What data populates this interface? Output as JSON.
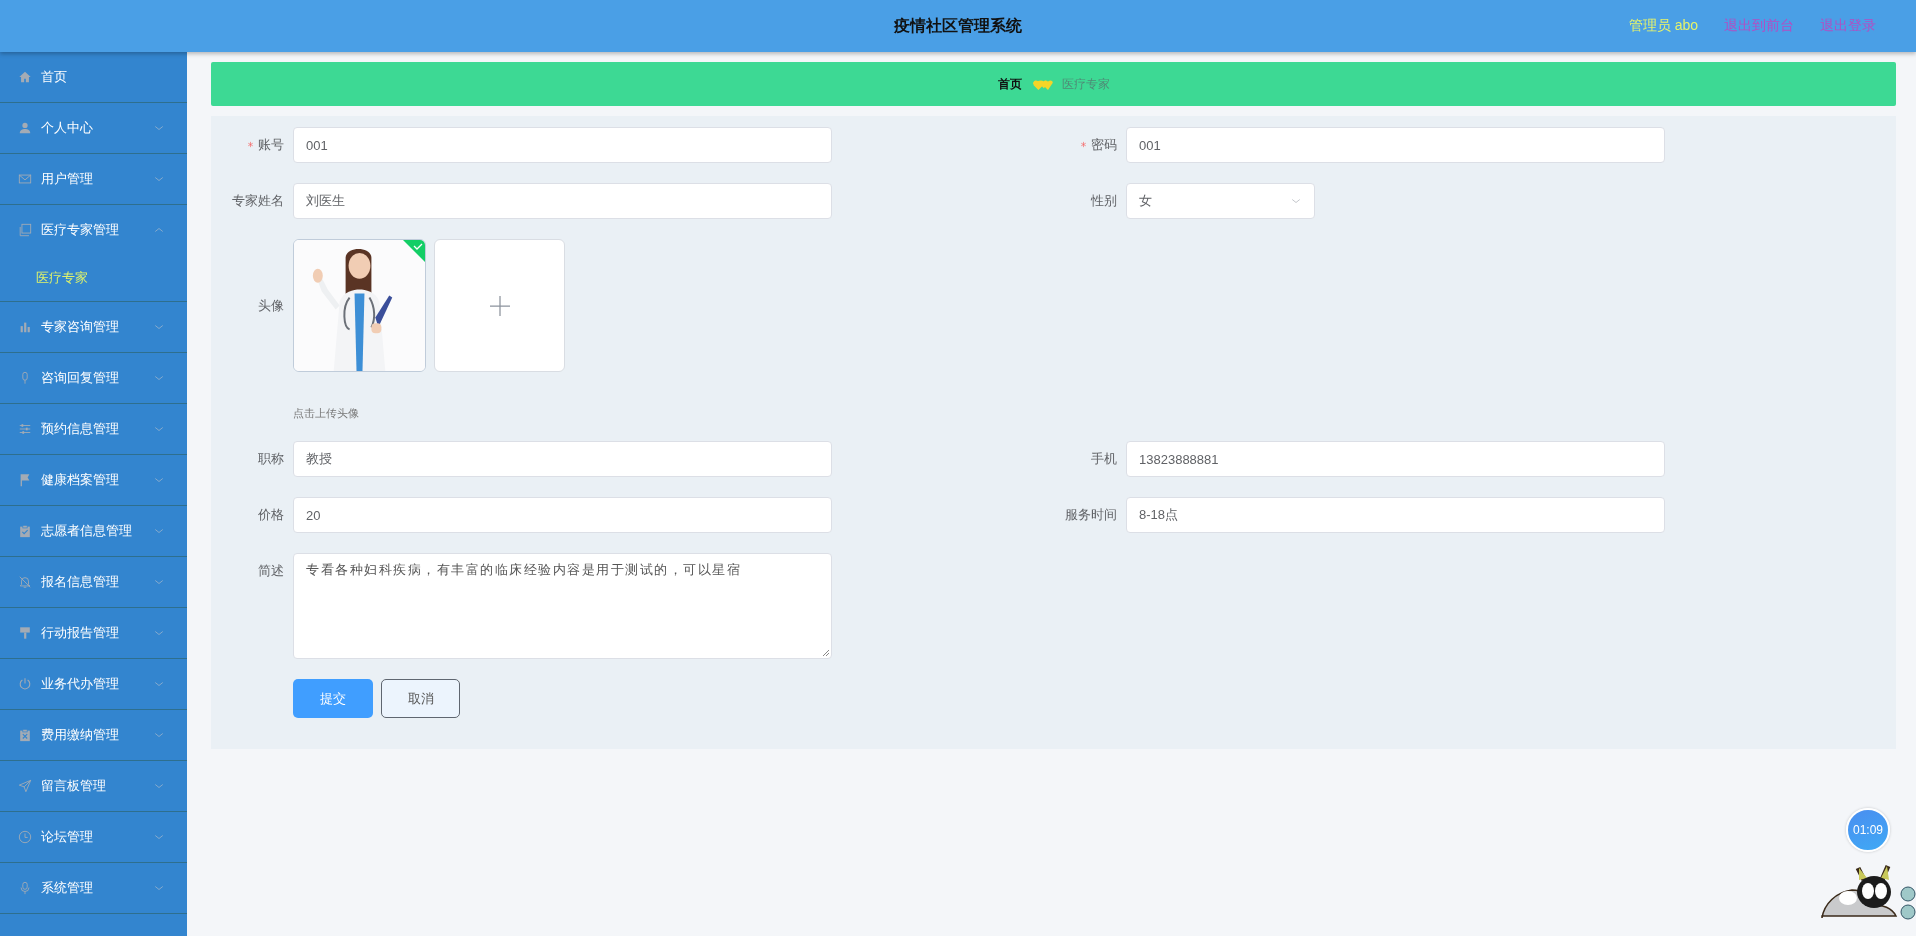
{
  "header": {
    "title": "疫情社区管理系统",
    "user": "管理员 abo",
    "links": [
      "退出到前台",
      "退出登录"
    ]
  },
  "sidebar": {
    "items": [
      {
        "label": "首页",
        "kind": "link"
      },
      {
        "label": "个人中心",
        "kind": "menu",
        "expanded": false
      },
      {
        "label": "用户管理",
        "kind": "menu",
        "expanded": false
      },
      {
        "label": "医疗专家管理",
        "kind": "menu",
        "expanded": true,
        "children": [
          {
            "label": "医疗专家",
            "selected": true
          }
        ]
      },
      {
        "label": "专家咨询管理",
        "kind": "menu",
        "expanded": false
      },
      {
        "label": "咨询回复管理",
        "kind": "menu",
        "expanded": false
      },
      {
        "label": "预约信息管理",
        "kind": "menu",
        "expanded": false
      },
      {
        "label": "健康档案管理",
        "kind": "menu",
        "expanded": false
      },
      {
        "label": "志愿者信息管理",
        "kind": "menu",
        "expanded": false
      },
      {
        "label": "报名信息管理",
        "kind": "menu",
        "expanded": false
      },
      {
        "label": "行动报告管理",
        "kind": "menu",
        "expanded": false
      },
      {
        "label": "业务代办管理",
        "kind": "menu",
        "expanded": false
      },
      {
        "label": "费用缴纳管理",
        "kind": "menu",
        "expanded": false
      },
      {
        "label": "留言板管理",
        "kind": "menu",
        "expanded": false
      },
      {
        "label": "论坛管理",
        "kind": "menu",
        "expanded": false
      },
      {
        "label": "系统管理",
        "kind": "menu",
        "expanded": false
      }
    ]
  },
  "breadcrumb": [
    {
      "label": "首页",
      "current": false
    },
    {
      "label": "医疗专家",
      "current": true
    }
  ],
  "form": {
    "rows": [
      [
        {
          "label": "账号",
          "required": true,
          "kind": "text",
          "value": "001"
        },
        {
          "label": "密码",
          "required": true,
          "kind": "text",
          "value": "001"
        }
      ],
      [
        {
          "label": "专家姓名",
          "required": false,
          "kind": "text",
          "value": "刘医生"
        },
        {
          "label": "性别",
          "required": false,
          "kind": "select",
          "value": "女"
        }
      ],
      [
        {
          "label": "头像",
          "required": false,
          "kind": "upload",
          "uploaded": true,
          "hint": "点击上传头像"
        }
      ],
      [
        {
          "label": "职称",
          "required": false,
          "kind": "text",
          "value": "教授"
        },
        {
          "label": "手机",
          "required": false,
          "kind": "text",
          "value": "13823888881"
        }
      ],
      [
        {
          "label": "价格",
          "required": false,
          "kind": "text",
          "value": "20"
        },
        {
          "label": "服务时间",
          "required": false,
          "kind": "text",
          "value": "8-18点"
        }
      ],
      [
        {
          "label": "简述",
          "required": false,
          "kind": "textarea",
          "value": "专看各种妇科疾病，有丰富的临床经验内容是用于测试的，可以星宿"
        }
      ]
    ],
    "buttons": [
      {
        "label": "提交",
        "kind": "primary"
      },
      {
        "label": "取消",
        "kind": "default"
      }
    ]
  },
  "timer": "01:09"
}
